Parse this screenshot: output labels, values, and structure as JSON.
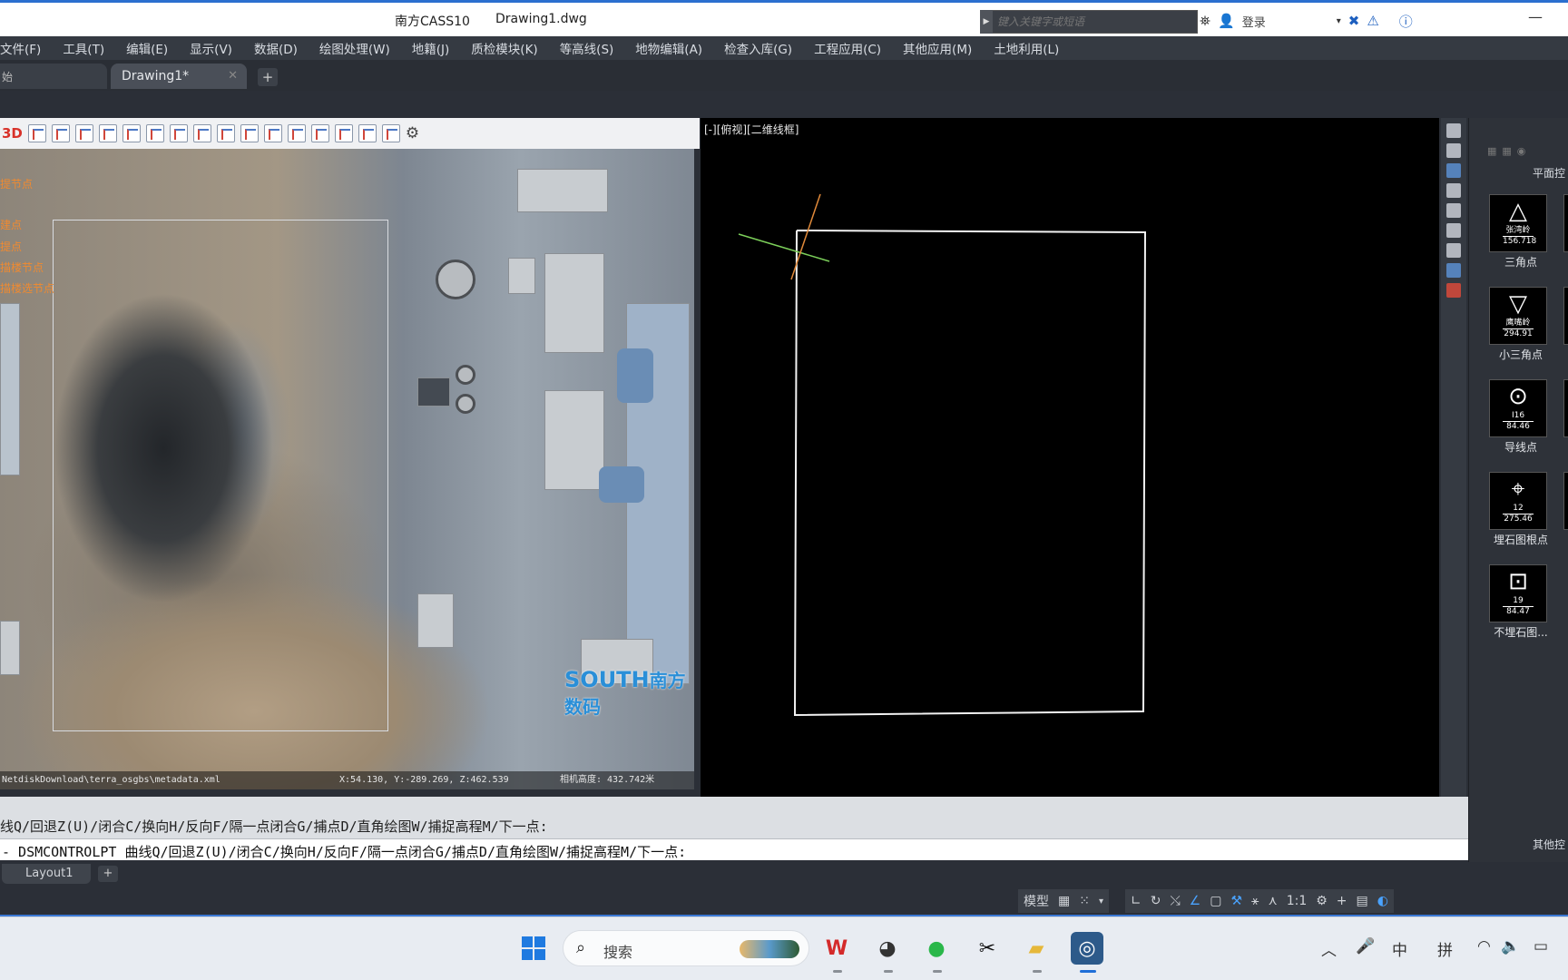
{
  "titlebar": {
    "app": "南方CASS10",
    "document": "Drawing1.dwg",
    "search_placeholder": "键入关键字或短语",
    "login": "登录"
  },
  "menu": [
    "文件(F)",
    "工具(T)",
    "编辑(E)",
    "显示(V)",
    "数据(D)",
    "绘图处理(W)",
    "地籍(J)",
    "质检模块(K)",
    "等高线(S)",
    "地物编辑(A)",
    "检查入库(G)",
    "工程应用(C)",
    "其他应用(M)",
    "土地利用(L)"
  ],
  "tabs": {
    "home_partial": "始",
    "active": "Drawing1*",
    "add": "+"
  },
  "photo_panel": {
    "toolbar_3d": "3D",
    "orange_labels": [
      "提节点",
      "建点",
      "提点",
      "描楼节点",
      "描楼选节点"
    ],
    "logo_latin": "SOUTH",
    "logo_cn": "南方数码",
    "status_path": "NetdiskDownload\\terra_osgbs\\metadata.xml",
    "status_xyz": "X:54.130, Y:-289.269, Z:462.539",
    "status_camera": "相机高度: 432.742米"
  },
  "cad_view": {
    "viewport_label": "[-][俯视][二维线框]"
  },
  "symbol_panel": {
    "title": "平面控",
    "items": [
      {
        "glyph": "△",
        "n1": "张湾岭",
        "n2": "156.718",
        "label": "三角点"
      },
      {
        "glyph": "▽",
        "n1": "鹰嘴岭",
        "n2": "294.91",
        "label": "小三角点"
      },
      {
        "glyph": "⊙",
        "n1": "I16",
        "n2": "84.46",
        "label": "导线点"
      },
      {
        "glyph": "⌖",
        "n1": "12",
        "n2": "275.46",
        "label": "埋石图根点"
      },
      {
        "glyph": "⊡",
        "n1": "19",
        "n2": "84.47",
        "label": "不埋石图..."
      }
    ],
    "footer": "其他控"
  },
  "command": {
    "history": "线Q/回退Z(U)/闭合C/换向H/反向F/隔一点闭合G/捕点D/直角绘图W/捕捉高程M/下一点:",
    "current": "- DSMCONTROLPT 曲线Q/回退Z(U)/闭合C/换向H/反向F/隔一点闭合G/捕点D/直角绘图W/捕捉高程M/下一点:"
  },
  "layout": {
    "tab": "Layout1",
    "add": "+"
  },
  "statusbar": {
    "model": "模型",
    "scale": "1:1"
  },
  "taskbar": {
    "search": "搜索",
    "ime_mode": "中",
    "ime_input": "拼"
  }
}
